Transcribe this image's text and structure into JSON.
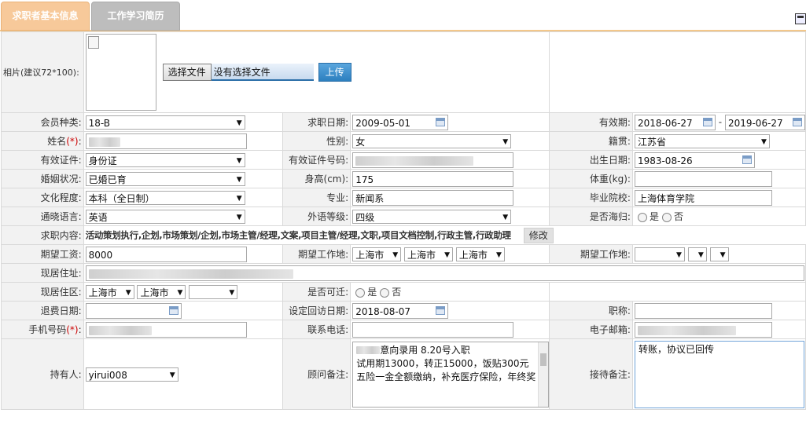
{
  "tabs": [
    {
      "label": "求职者基本信息",
      "active": true
    },
    {
      "label": "工作学习简历",
      "active": false
    }
  ],
  "photo": {
    "label": "相片(建议72*100):",
    "file_button": "选择文件",
    "file_status": "没有选择文件",
    "upload_button": "上传"
  },
  "rows": {
    "member_type": {
      "label": "会员种类:",
      "value": "18-B"
    },
    "job_date": {
      "label": "求职日期:",
      "value": "2009-05-01"
    },
    "validity": {
      "label": "有效期:",
      "from": "2018-06-27",
      "sep": "-",
      "to": "2019-06-27"
    },
    "name": {
      "label": "姓名",
      "req": "(*)",
      "colon": ":"
    },
    "gender": {
      "label": "性别:",
      "value": "女"
    },
    "native": {
      "label": "籍贯:",
      "value": "江苏省"
    },
    "id_type": {
      "label": "有效证件:",
      "value": "身份证"
    },
    "id_number": {
      "label": "有效证件号码:"
    },
    "birth": {
      "label": "出生日期:",
      "value": "1983-08-26"
    },
    "marital": {
      "label": "婚姻状况:",
      "value": "已婚已育"
    },
    "height": {
      "label": "身高(cm):",
      "value": "175"
    },
    "weight": {
      "label": "体重(kg):",
      "value": ""
    },
    "education": {
      "label": "文化程度:",
      "value": "本科（全日制）"
    },
    "major": {
      "label": "专业:",
      "value": "新闻系"
    },
    "school": {
      "label": "毕业院校:",
      "value": "上海体育学院"
    },
    "language": {
      "label": "通晓语言:",
      "value": "英语"
    },
    "lang_level": {
      "label": "外语等级:",
      "value": "四级"
    },
    "overseas": {
      "label": "是否海归:",
      "yes": "是",
      "no": "否"
    },
    "intent": {
      "label": "求职内容:",
      "value": "活动策划执行,企划,市场策划/企划,市场主管/经理,文案,项目主管/经理,文职,项目文档控制,行政主管,行政助理",
      "modify": "修改"
    },
    "salary": {
      "label": "期望工资:",
      "value": "8000"
    },
    "work_place1": {
      "label": "期望工作地:",
      "a": "上海市",
      "b": "上海市",
      "c": "上海市"
    },
    "work_place2": {
      "label": "期望工作地:"
    },
    "address": {
      "label": "现居住址:"
    },
    "district": {
      "label": "现居住区:",
      "a": "上海市",
      "b": "上海市"
    },
    "relocate": {
      "label": "是否可迁:",
      "yes": "是",
      "no": "否"
    },
    "refund_date": {
      "label": "退费日期:"
    },
    "visit_date": {
      "label": "设定回访日期:",
      "value": "2018-08-07"
    },
    "title": {
      "label": "职称:"
    },
    "mobile": {
      "label": "手机号码",
      "req": "(*)",
      "colon": ":"
    },
    "phone": {
      "label": "联系电话:"
    },
    "email": {
      "label": "电子邮箱:"
    },
    "owner": {
      "label": "持有人:",
      "value": "yirui008"
    },
    "consultant_note": {
      "label": "顾问备注:",
      "lines": [
        "意向录用  8.20号入职",
        "试用期13000，转正15000，饭贴300元",
        "五险一金全额缴纳，补充医疗保险，年终奖"
      ]
    },
    "reception_note": {
      "label": "接待备注:",
      "value": "转账，协议已回传"
    }
  }
}
